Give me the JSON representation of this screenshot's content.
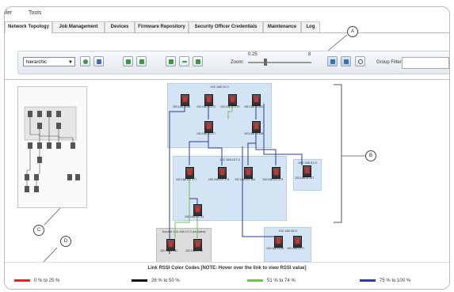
{
  "menubar": {
    "items": [
      "ller",
      "Tools"
    ]
  },
  "tabs": [
    {
      "label": "Network Topology",
      "active": true
    },
    {
      "label": "Job Management"
    },
    {
      "label": "Devices"
    },
    {
      "label": "Firmware Repository"
    },
    {
      "label": "Security Officer Credentials"
    },
    {
      "label": "Maintenance"
    },
    {
      "label": "Log"
    }
  ],
  "toolbar": {
    "layout_select": "hierarchic",
    "zoom_label": "Zoom:",
    "zoom_min": "0.25",
    "zoom_max": "8",
    "group_filter_label": "Group Filter"
  },
  "groups": [
    {
      "title": "192.168.10.0"
    },
    {
      "title": "192.168.107.0"
    },
    {
      "title": "192.168.31.0"
    },
    {
      "title": "192.168.15.0"
    },
    {
      "title": "Subnet 192.168.17.0 (Isolated)"
    }
  ],
  "devices": {
    "g1_row1": [
      "192.168.10.66",
      "192.168.10.172",
      "192.168.10.179",
      "192.168.10.202"
    ],
    "g1_row2": [
      "192.168.10.177",
      "192.168.10.138"
    ],
    "g2_row": [
      "192.168.107.177",
      "192.168.107.174",
      "192.168.107.161",
      "192.168.107.179"
    ],
    "g2_sub": "192.168.107.41",
    "g3": "192.168.31.137",
    "g4": [
      "192.168.15.40",
      "192.168.15.77"
    ],
    "g5": [
      "192.168.17.41",
      "192.168.17.42"
    ]
  },
  "legend": {
    "title": "Link RSSI Color Codes [NOTE: Hover over the link to view RSSI value]",
    "items": [
      {
        "label": "0 % to 25 %",
        "color": "#e0252b"
      },
      {
        "label": "26 % to 50 %",
        "color": "#111111"
      },
      {
        "label": "51 % to 74 %",
        "color": "#6cc24a"
      },
      {
        "label": "75 % to 100 %",
        "color": "#2b3d91"
      }
    ]
  },
  "callouts": [
    "A",
    "B",
    "C",
    "D"
  ]
}
